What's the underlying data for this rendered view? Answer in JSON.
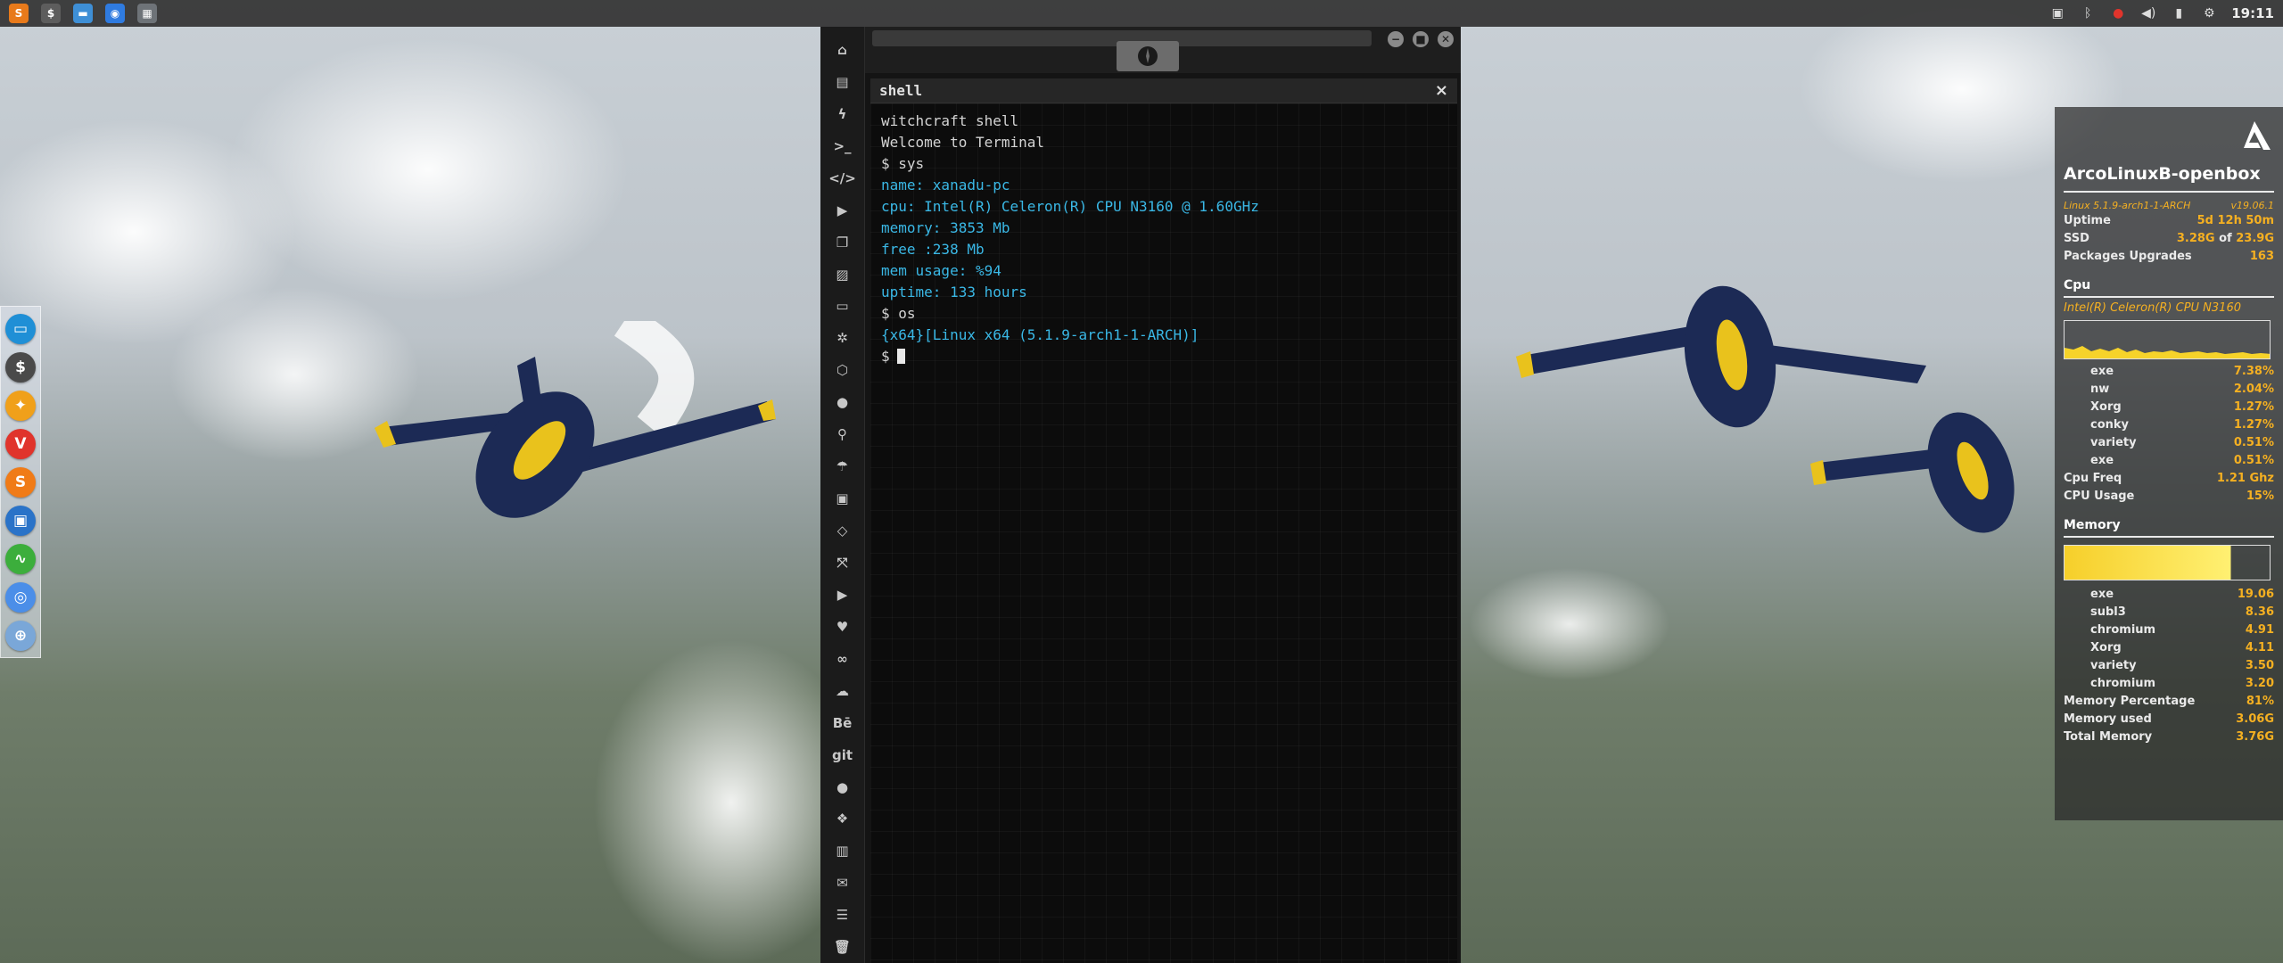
{
  "top_panel": {
    "launchers": [
      {
        "name": "sublime-launcher",
        "glyph": "S",
        "color": "#e87a1b"
      },
      {
        "name": "terminal-launcher",
        "glyph": "$",
        "color": "#5d5d5d"
      },
      {
        "name": "files-launcher",
        "glyph": "▬",
        "color": "#3e8fd6"
      },
      {
        "name": "chrome-launcher",
        "glyph": "◉",
        "color": "#2f7be0"
      },
      {
        "name": "desktop-launcher",
        "glyph": "▦",
        "color": "#6e7378"
      }
    ],
    "tray_icons": [
      "image-viewer-icon",
      "bluetooth-icon",
      "record-icon",
      "volume-icon",
      "battery-icon",
      "settings-icon"
    ],
    "clock": "19:11"
  },
  "dock": {
    "items": [
      {
        "name": "file-manager",
        "glyph": "▭",
        "color": "#1f8fd6"
      },
      {
        "name": "terminal",
        "glyph": "$",
        "color": "#4a4a4a"
      },
      {
        "name": "settings",
        "glyph": "✦",
        "color": "#f0a01a"
      },
      {
        "name": "vivaldi",
        "glyph": "V",
        "color": "#e0342c"
      },
      {
        "name": "sublime",
        "glyph": "S",
        "color": "#f07b17"
      },
      {
        "name": "screenshot",
        "glyph": "▣",
        "color": "#2a73c8"
      },
      {
        "name": "system-monitor",
        "glyph": "∿",
        "color": "#3cae3c"
      },
      {
        "name": "chromium",
        "glyph": "◎",
        "color": "#4b8ee8"
      },
      {
        "name": "network",
        "glyph": "⊕",
        "color": "#7aa7d8"
      }
    ]
  },
  "app": {
    "sidebar_icons": [
      {
        "name": "home-icon",
        "glyph": "⌂"
      },
      {
        "name": "document-icon",
        "glyph": "▤"
      },
      {
        "name": "lightning-icon",
        "glyph": "ϟ"
      },
      {
        "name": "terminal-prompt-icon",
        "glyph": ">_"
      },
      {
        "name": "code-icon",
        "glyph": "</>"
      },
      {
        "name": "play-icon",
        "glyph": "▶"
      },
      {
        "name": "copy-icon",
        "glyph": "❐"
      },
      {
        "name": "image-icon",
        "glyph": "▨"
      },
      {
        "name": "card-icon",
        "glyph": "▭"
      },
      {
        "name": "react-icon",
        "glyph": "✲"
      },
      {
        "name": "hexagon-icon",
        "glyph": "⬡"
      },
      {
        "name": "globe-icon",
        "glyph": "●"
      },
      {
        "name": "search-icon",
        "glyph": "⚲"
      },
      {
        "name": "umbrella-icon",
        "glyph": "☂"
      },
      {
        "name": "contact-icon",
        "glyph": "▣"
      },
      {
        "name": "diamond-code-icon",
        "glyph": "◇"
      },
      {
        "name": "expand-icon",
        "glyph": "⤧"
      },
      {
        "name": "youtube-icon",
        "glyph": "▶"
      },
      {
        "name": "heart-icon",
        "glyph": "♥"
      },
      {
        "name": "cloud-outline-icon",
        "glyph": "∞"
      },
      {
        "name": "cloud-icon",
        "glyph": "☁"
      },
      {
        "name": "behance-icon",
        "glyph": "Bē"
      },
      {
        "name": "git-icon",
        "glyph": "git"
      },
      {
        "name": "github-icon",
        "glyph": "●"
      },
      {
        "name": "cubes-icon",
        "glyph": "❖"
      },
      {
        "name": "map-icon",
        "glyph": "▥"
      },
      {
        "name": "mail-icon",
        "glyph": "✉"
      },
      {
        "name": "server-icon",
        "glyph": "☰"
      },
      {
        "name": "trash-icon",
        "glyph": "🗑"
      }
    ],
    "window_controls": [
      "−",
      "■",
      "✕"
    ],
    "shell_tab": {
      "label": "shell",
      "close": "×"
    },
    "terminal_lines": [
      {
        "text": "witchcraft shell",
        "style": "white"
      },
      {
        "text": "Welcome to Terminal",
        "style": "white"
      },
      {
        "text": "$ sys",
        "style": "white"
      },
      {
        "text": "name: xanadu-pc",
        "style": "cyan"
      },
      {
        "text": "cpu: Intel(R) Celeron(R) CPU N3160 @ 1.60GHz",
        "style": "cyan"
      },
      {
        "text": "memory: 3853 Mb",
        "style": "cyan"
      },
      {
        "text": "free :238 Mb",
        "style": "cyan"
      },
      {
        "text": "mem usage: %94",
        "style": "cyan"
      },
      {
        "text": "uptime: 133 hours",
        "style": "cyan"
      },
      {
        "text": "$ os",
        "style": "white"
      },
      {
        "text": "{x64}[Linux x64 (5.1.9-arch1-1-ARCH)]",
        "style": "cyan"
      }
    ],
    "prompt": "$"
  },
  "conky": {
    "title": "ArcoLinuxB-openbox",
    "kernel": "Linux 5.1.9-arch1-1-ARCH",
    "version": "v19.06.1",
    "uptime_label": "Uptime",
    "uptime": "5d 12h 50m",
    "ssd_label": "SSD",
    "ssd_used": "3.28G",
    "ssd_of": "of",
    "ssd_total": "23.9G",
    "packages_label": "Packages Upgrades",
    "packages": "163",
    "cpu_section": "Cpu",
    "cpu_name": "Intel(R) Celeron(R) CPU  N3160",
    "cpu_procs": [
      {
        "name": "exe",
        "value": "7.38%"
      },
      {
        "name": "nw",
        "value": "2.04%"
      },
      {
        "name": "Xorg",
        "value": "1.27%"
      },
      {
        "name": "conky",
        "value": "1.27%"
      },
      {
        "name": "variety",
        "value": "0.51%"
      },
      {
        "name": "exe",
        "value": "0.51%"
      }
    ],
    "cpu_freq_label": "Cpu Freq",
    "cpu_freq": "1.21 Ghz",
    "cpu_usage_label": "CPU Usage",
    "cpu_usage": "15%",
    "memory_section": "Memory",
    "memory_fill": 0.81,
    "mem_procs": [
      {
        "name": "exe",
        "value": "19.06"
      },
      {
        "name": "subl3",
        "value": "8.36"
      },
      {
        "name": "chromium",
        "value": "4.91"
      },
      {
        "name": "Xorg",
        "value": "4.11"
      },
      {
        "name": "variety",
        "value": "3.50"
      },
      {
        "name": "chromium",
        "value": "3.20"
      }
    ],
    "mem_pct_label": "Memory Percentage",
    "mem_pct": "81%",
    "mem_used_label": "Memory used",
    "mem_used": "3.06G",
    "mem_total_label": "Total Memory",
    "mem_total": "3.76G",
    "accent": "#f5b021"
  }
}
